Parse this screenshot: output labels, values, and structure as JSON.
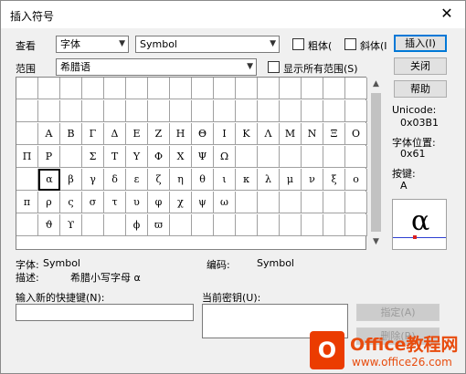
{
  "window": {
    "title": "插入符号",
    "close_glyph": "✕"
  },
  "font_row": {
    "label": "查看",
    "category_value": "字体",
    "font_value": "Symbol",
    "bold_label": "粗体(",
    "italic_label": "斜体(I"
  },
  "range_row": {
    "label": "范围",
    "range_value": "希腊语",
    "show_all_label": "显示所有范围(S)"
  },
  "buttons": {
    "insert": "插入(I)",
    "close": "关闭",
    "help": "帮助",
    "assign": "指定(A)",
    "remove": "删除(R)"
  },
  "info_panel": {
    "unicode_label": "Unicode:",
    "unicode_value": "0x03B1",
    "position_label": "字体位置:",
    "position_value": "0x61",
    "keystroke_label": "按键:",
    "keystroke_value": "A",
    "preview_glyph": "α"
  },
  "symbol_grid": {
    "columns": 16,
    "rows": [
      [
        "",
        "",
        "",
        "",
        "",
        "",
        "",
        "",
        "",
        "",
        "",
        "",
        "",
        "",
        "",
        ""
      ],
      [
        "",
        "",
        "",
        "",
        "",
        "",
        "",
        "",
        "",
        "",
        "",
        "",
        "",
        "",
        "",
        ""
      ],
      [
        "",
        "Α",
        "Β",
        "Γ",
        "Δ",
        "Ε",
        "Ζ",
        "Η",
        "Θ",
        "Ι",
        "Κ",
        "Λ",
        "Μ",
        "Ν",
        "Ξ",
        "Ο"
      ],
      [
        "Π",
        "Ρ",
        "",
        "Σ",
        "Τ",
        "Υ",
        "Φ",
        "Χ",
        "Ψ",
        "Ω",
        "",
        "",
        "",
        "",
        "",
        ""
      ],
      [
        "",
        "α",
        "β",
        "γ",
        "δ",
        "ε",
        "ζ",
        "η",
        "θ",
        "ι",
        "κ",
        "λ",
        "μ",
        "ν",
        "ξ",
        "ο"
      ],
      [
        "π",
        "ρ",
        "ς",
        "σ",
        "τ",
        "υ",
        "φ",
        "χ",
        "ψ",
        "ω",
        "",
        "",
        "",
        "",
        "",
        ""
      ],
      [
        "",
        "ϑ",
        "ϒ",
        "",
        "",
        "ϕ",
        "ϖ",
        "",
        "",
        "",
        "",
        "",
        "",
        "",
        "",
        ""
      ]
    ],
    "selected": {
      "row": 4,
      "col": 1
    }
  },
  "details": {
    "font_label": "字体:",
    "font_value": "Symbol",
    "code_label": "编码:",
    "code_value": "Symbol",
    "desc_label": "描述:",
    "desc_value": "希腊小写字母 α"
  },
  "shortcut": {
    "new_label": "输入新的快捷键(N):",
    "new_value": "",
    "current_label": "当前密钥(U):"
  },
  "watermark": {
    "brand": "Office教程网",
    "url": "www.office26.com"
  },
  "colors": {
    "accent": "#0078d7",
    "watermark": "#eb3c00"
  }
}
